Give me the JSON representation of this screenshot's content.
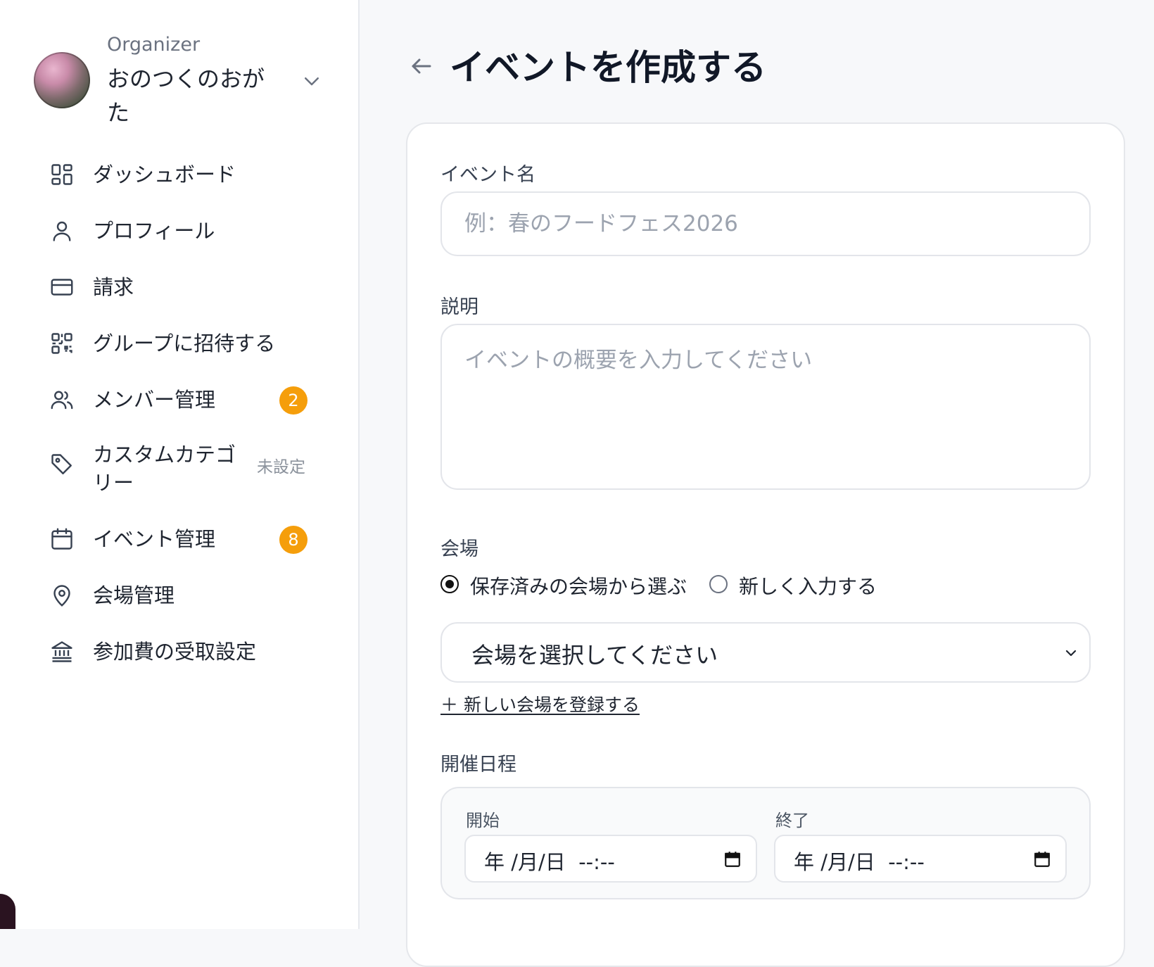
{
  "org": {
    "role": "Organizer",
    "name": "おのつくのおがた"
  },
  "nav": {
    "items": [
      {
        "label": "ダッシュボード",
        "icon": "dashboard-icon"
      },
      {
        "label": "プロフィール",
        "icon": "user-icon"
      },
      {
        "label": "請求",
        "icon": "credit-card-icon"
      },
      {
        "label": "グループに招待する",
        "icon": "qr-code-icon"
      },
      {
        "label": "メンバー管理",
        "icon": "users-icon",
        "badge": "2"
      },
      {
        "label": "カスタムカテゴリー",
        "icon": "tag-icon",
        "tag": "未設定"
      },
      {
        "label": "イベント管理",
        "icon": "calendar-icon",
        "badge": "8"
      },
      {
        "label": "会場管理",
        "icon": "map-pin-icon"
      },
      {
        "label": "参加費の受取設定",
        "icon": "bank-icon"
      }
    ]
  },
  "page": {
    "title": "イベントを作成する"
  },
  "form": {
    "event_name": {
      "label": "イベント名",
      "placeholder": "例：春のフードフェス2026",
      "value": ""
    },
    "description": {
      "label": "説明",
      "placeholder": "イベントの概要を入力してください",
      "value": ""
    },
    "venue": {
      "label": "会場",
      "option_saved": "保存済みの会場から選ぶ",
      "option_new": "新しく入力する",
      "selected_option": "saved",
      "select_value": "会場を選択してください",
      "add_link": "＋ 新しい会場を登録する"
    },
    "schedule": {
      "label": "開催日程",
      "start_label": "開始",
      "end_label": "終了",
      "start_value": "年 /月/日  --:--",
      "end_value": "年 /月/日  --:--"
    }
  },
  "colors": {
    "badge": "#f59e0b",
    "accent_text": "#111827"
  }
}
